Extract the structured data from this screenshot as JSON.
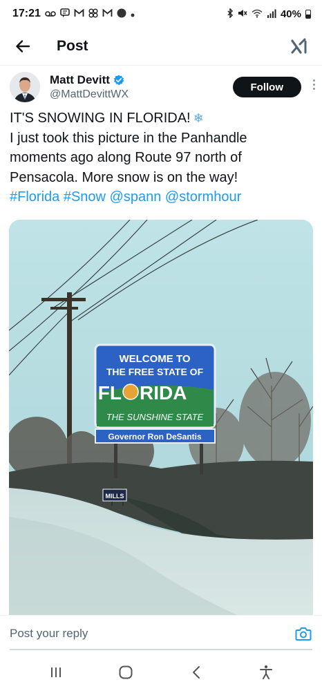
{
  "status_bar": {
    "time": "17:21",
    "left_icons": [
      "voicemail-icon",
      "chat-icon",
      "gmail-icon",
      "pinwheel-icon",
      "gmail-icon",
      "circle-app-icon",
      "dot-icon"
    ],
    "right_icons": [
      "bluetooth-icon",
      "mute-icon",
      "wifi-icon",
      "signal-icon"
    ],
    "battery": "40%"
  },
  "header": {
    "title": "Post"
  },
  "author": {
    "display_name": "Matt Devitt",
    "handle": "@MattDevittWX",
    "verified": true,
    "follow_label": "Follow"
  },
  "post": {
    "line1": "IT'S SNOWING IN FLORIDA!",
    "line2": "I just took this picture in the Panhandle",
    "line3": "moments ago along Route 97 north of",
    "line4": "Pensacola. More snow is on the way!",
    "hashtag1": "#Florida",
    "hashtag2": "#Snow",
    "mention1": "@spann",
    "mention2": "@stormhour",
    "emoji": "❄"
  },
  "photo": {
    "sign_line1": "WELCOME TO",
    "sign_line2": "THE FREE STATE OF",
    "sign_line3a": "FL",
    "sign_line3b": "RIDA",
    "sign_line4": "THE SUNSHINE STATE",
    "sign_plate": "Governor Ron DeSantis",
    "yard_sign": "MILLS"
  },
  "reply": {
    "placeholder": "Post your reply"
  },
  "colors": {
    "accent": "#1d9bf0",
    "text": "#0f1419",
    "secondary": "#536471"
  }
}
